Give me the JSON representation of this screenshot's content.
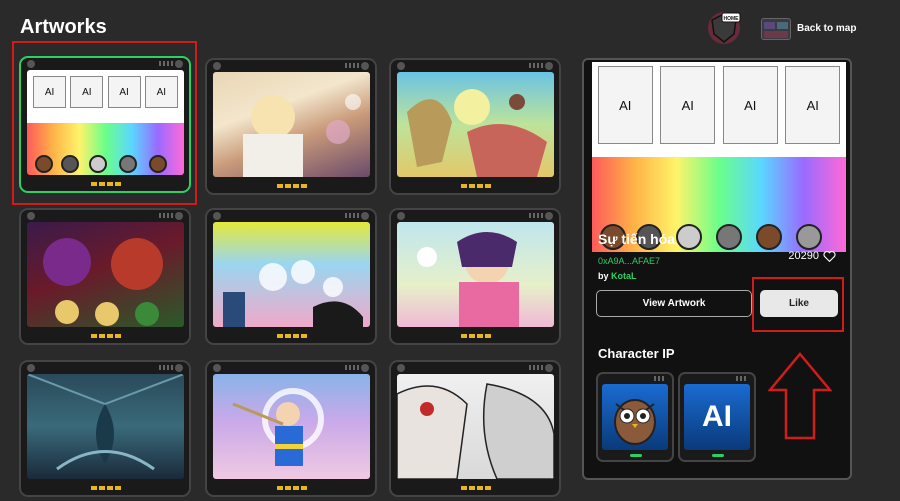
{
  "page": {
    "title": "Artworks"
  },
  "topbar": {
    "back_label": "Back to map",
    "avatar_badge": "HOME"
  },
  "grid": {
    "cards": [
      {
        "name": "card-1",
        "selected": true
      },
      {
        "name": "card-2"
      },
      {
        "name": "card-3"
      },
      {
        "name": "card-4"
      },
      {
        "name": "card-5"
      },
      {
        "name": "card-6"
      },
      {
        "name": "card-7"
      },
      {
        "name": "card-8"
      },
      {
        "name": "card-9"
      }
    ],
    "ai_label": "AI"
  },
  "detail": {
    "title": "Sự tiến hóa",
    "address": "0xA9A...AFAE7",
    "by_prefix": "by",
    "author": "KotaL",
    "likes": "20290",
    "view_button": "View Artwork",
    "like_button": "Like",
    "ai_label": "AI"
  },
  "character_ip": {
    "title": "Character IP",
    "items": [
      {
        "icon": "owl-icon"
      },
      {
        "label": "AI"
      }
    ]
  },
  "colors": {
    "selected_border": "#2ecf63",
    "highlight": "#d11c1c",
    "accent_green": "#2ecf63"
  }
}
